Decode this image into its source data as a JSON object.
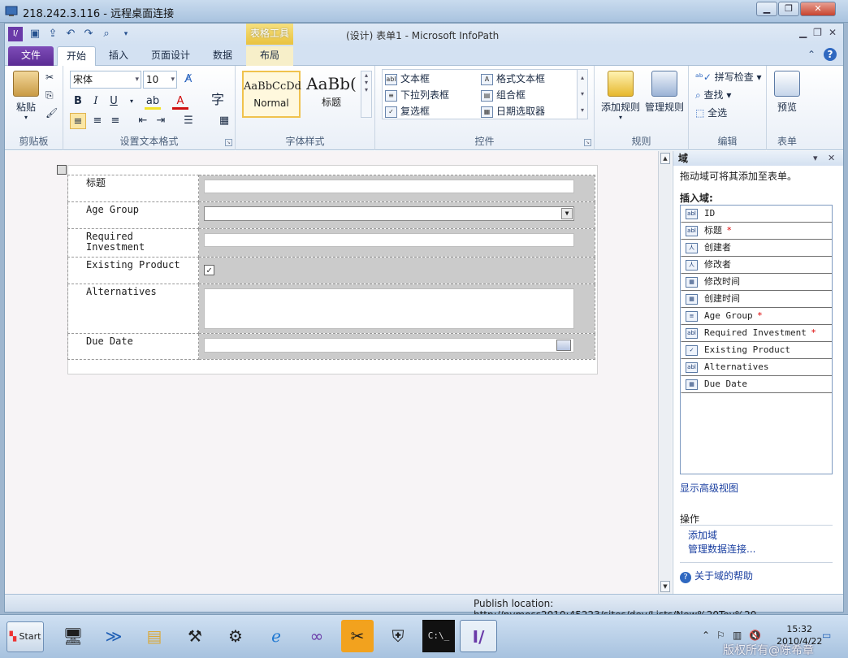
{
  "rdp": {
    "title": "218.242.3.116 - 远程桌面连接"
  },
  "window": {
    "title": "(设计) 表单1 - Microsoft InfoPath",
    "context_tab_group": "表格工具"
  },
  "tabs": [
    {
      "label": "文件"
    },
    {
      "label": "开始"
    },
    {
      "label": "插入"
    },
    {
      "label": "页面设计"
    },
    {
      "label": "数据"
    },
    {
      "label": "布局"
    }
  ],
  "ribbon": {
    "clipboard": {
      "label": "剪贴板",
      "paste": "粘贴"
    },
    "font": {
      "label": "设置文本格式",
      "name": "宋体",
      "size": "10",
      "bold": "B",
      "italic": "I",
      "underline": "U",
      "char": "字"
    },
    "styles": {
      "label": "字体样式",
      "normal_preview": "AaBbCcDd",
      "normal_name": "Normal",
      "heading_preview": "AaBb(",
      "heading_name": "标题"
    },
    "controls": {
      "label": "控件",
      "items": [
        "文本框",
        "格式文本框",
        "下拉列表框",
        "组合框",
        "复选框",
        "日期选取器"
      ]
    },
    "rules": {
      "label": "规则",
      "add": "添加规则",
      "manage": "管理规则"
    },
    "editing": {
      "label": "编辑",
      "spell": "拼写检查",
      "find": "查找",
      "select_all": "全选"
    },
    "form": {
      "label": "表单",
      "preview": "预览"
    }
  },
  "form": {
    "rows": [
      {
        "label": "标题",
        "control": "text"
      },
      {
        "label": "Age Group",
        "control": "dropdown"
      },
      {
        "label": "Required\nInvestment",
        "control": "text"
      },
      {
        "label": "Existing Product",
        "control": "checkbox"
      },
      {
        "label": "Alternatives",
        "control": "textarea"
      },
      {
        "label": "Due Date",
        "control": "date"
      }
    ]
  },
  "pane": {
    "title": "域",
    "hint": "拖动域可将其添加至表单。",
    "insert_label": "插入域:",
    "fields": [
      {
        "name": "ID",
        "icon": "text-field-icon",
        "badge": "abl",
        "required": false,
        "mono": true
      },
      {
        "name": "标题",
        "icon": "text-field-icon",
        "badge": "abl",
        "required": true,
        "mono": false
      },
      {
        "name": "创建者",
        "icon": "user-field-icon",
        "badge": "人",
        "required": false,
        "mono": false
      },
      {
        "name": "修改者",
        "icon": "user-field-icon",
        "badge": "人",
        "required": false,
        "mono": false
      },
      {
        "name": "修改时间",
        "icon": "date-field-icon",
        "badge": "▦",
        "required": false,
        "mono": false
      },
      {
        "name": "创建时间",
        "icon": "date-field-icon",
        "badge": "▦",
        "required": false,
        "mono": false
      },
      {
        "name": "Age Group",
        "icon": "dropdown-field-icon",
        "badge": "≡",
        "required": true,
        "mono": true
      },
      {
        "name": "Required Investment",
        "icon": "text-field-icon",
        "badge": "abl",
        "required": true,
        "mono": true
      },
      {
        "name": "Existing Product",
        "icon": "checkbox-field-icon",
        "badge": "✓",
        "required": false,
        "mono": true
      },
      {
        "name": "Alternatives",
        "icon": "text-field-icon",
        "badge": "abl",
        "required": false,
        "mono": true
      },
      {
        "name": "Due Date",
        "icon": "date-field-icon",
        "badge": "▦",
        "required": false,
        "mono": true
      }
    ],
    "required_mark": "*",
    "advanced_view": "显示高级视图",
    "actions_label": "操作",
    "add_field": "添加域",
    "manage_connections": "管理数据连接...",
    "help": "关于域的帮助"
  },
  "status": {
    "publish": "Publish location: http://nymoss2010:45223/sites/dev/Lists/New%20Toy%20..."
  },
  "taskbar": {
    "start": "Start",
    "time": "15:32",
    "date": "2010/4/22",
    "watermark": "版权所有@陈希章"
  },
  "colors": {
    "file_tab": "#6a3aa8",
    "context_tab": "#e9c23f",
    "required": "#dd0000",
    "link": "#1a3fa0"
  }
}
